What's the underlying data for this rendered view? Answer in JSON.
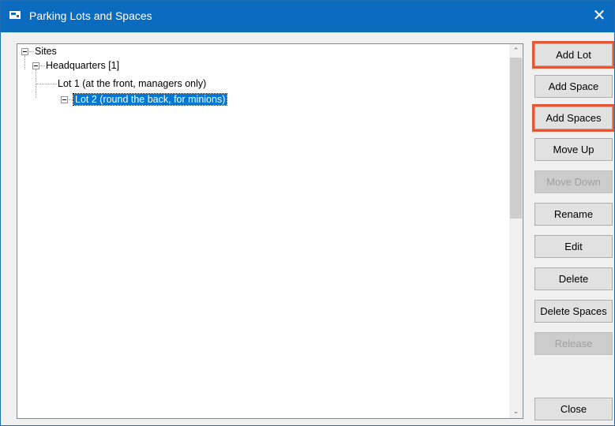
{
  "window": {
    "title": "Parking Lots and Spaces",
    "close_glyph": "✕"
  },
  "tree": {
    "root": {
      "label": "Sites",
      "expanded": true
    },
    "site": {
      "label": "Headquarters [1]",
      "expanded": true
    },
    "lots": [
      {
        "label": "Lot 1 (at the front, managers only)",
        "selected": false
      },
      {
        "label": "Lot 2 (round the back, for minions)",
        "selected": true,
        "expanded": true
      }
    ]
  },
  "scrollbar": {
    "up_glyph": "⌃",
    "down_glyph": "⌄"
  },
  "buttons": {
    "add_lot": {
      "label": "Add Lot",
      "enabled": true,
      "highlighted": true
    },
    "add_space": {
      "label": "Add Space",
      "enabled": true
    },
    "add_spaces": {
      "label": "Add Spaces",
      "enabled": true,
      "highlighted": true
    },
    "move_up": {
      "label": "Move Up",
      "enabled": true
    },
    "move_down": {
      "label": "Move Down",
      "enabled": false
    },
    "rename": {
      "label": "Rename",
      "enabled": true
    },
    "edit": {
      "label": "Edit",
      "enabled": true
    },
    "delete": {
      "label": "Delete",
      "enabled": true
    },
    "delete_spaces": {
      "label": "Delete Spaces",
      "enabled": true
    },
    "release": {
      "label": "Release",
      "enabled": false
    },
    "close": {
      "label": "Close",
      "enabled": true
    }
  },
  "colors": {
    "titlebar": "#0b6cbf",
    "selection": "#0078d7",
    "highlight_outline": "#e05a3a"
  }
}
